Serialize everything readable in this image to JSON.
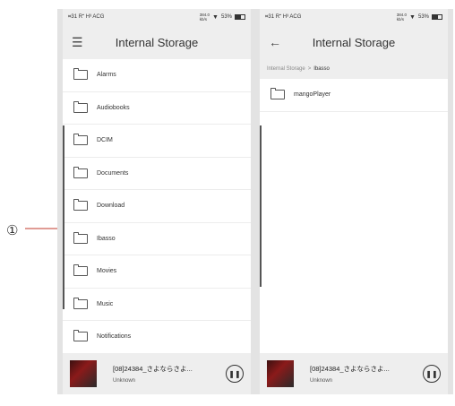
{
  "statusbar_left": {
    "status": "⌗31 R⁺ H³ ACG",
    "speed_value": "384.0",
    "speed_unit": "kb/s",
    "battery": "53%"
  },
  "statusbar_right": {
    "status": "⌗31 R⁺ H³ ACG",
    "speed_value": "384.0",
    "speed_unit": "kb/s",
    "battery": "53%"
  },
  "left_screen": {
    "title": "Internal Storage",
    "folders": [
      {
        "label": "Alarms"
      },
      {
        "label": "Audiobooks"
      },
      {
        "label": "DCIM"
      },
      {
        "label": "Documents"
      },
      {
        "label": "Download"
      },
      {
        "label": "Ibasso"
      },
      {
        "label": "Movies"
      },
      {
        "label": "Music"
      },
      {
        "label": "Notifications"
      }
    ]
  },
  "right_screen": {
    "title": "Internal Storage",
    "breadcrumb": {
      "root": "Internal Storage",
      "sep": ">",
      "current": "Ibasso"
    },
    "folders": [
      {
        "label": "mangoPlayer"
      }
    ]
  },
  "player": {
    "track_title": "[08]24384_さよならさよ...",
    "artist": "Unknown"
  },
  "callout": {
    "label": "①"
  }
}
